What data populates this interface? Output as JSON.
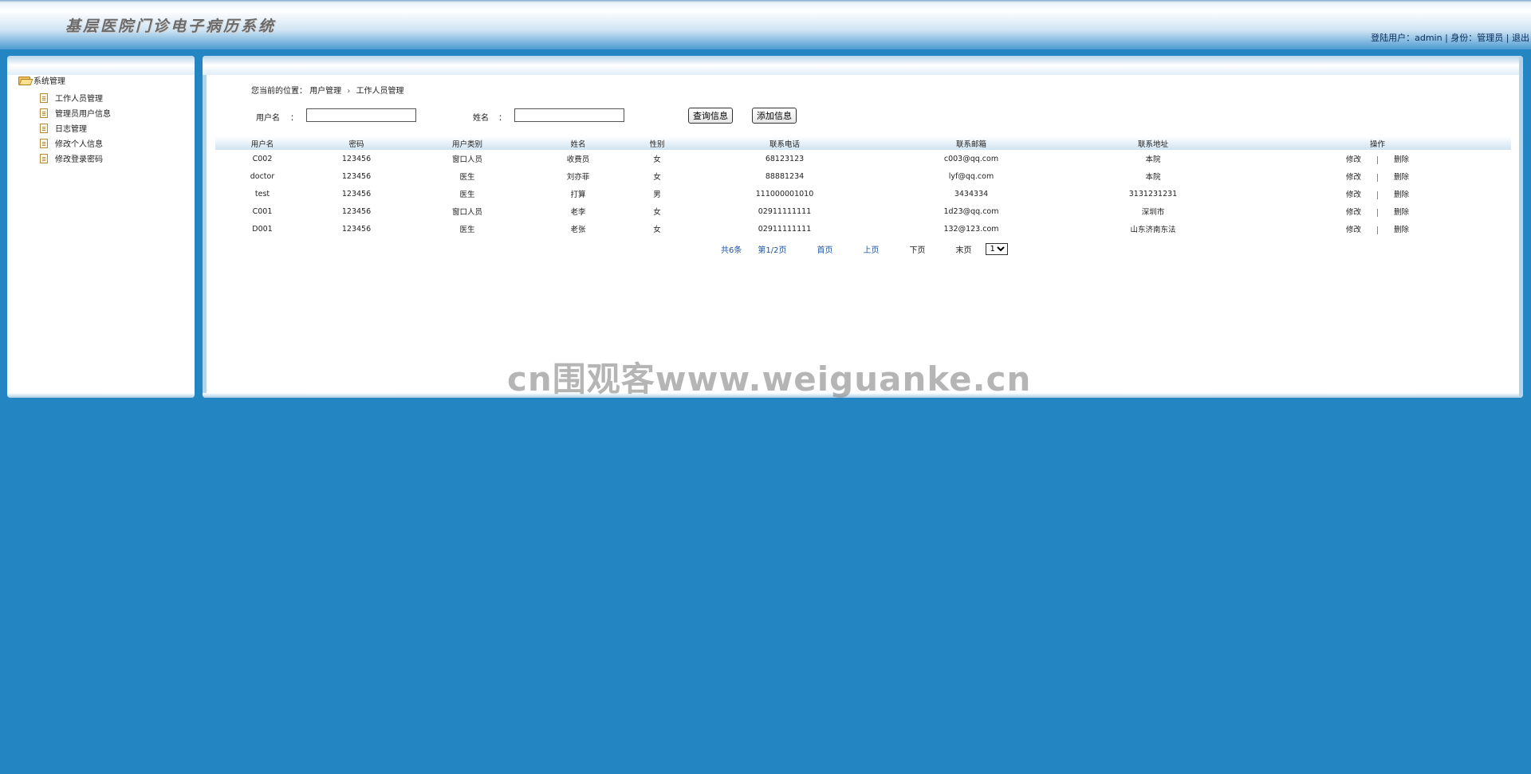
{
  "header": {
    "title": "基层医院门诊电子病历系统",
    "user_label": "登陆用户：",
    "user_name": "admin",
    "separator": "|",
    "role_label": "身份：",
    "role": "管理员",
    "logout": "退出"
  },
  "sidebar": {
    "root": "系统管理",
    "items": [
      {
        "label": "工作人员管理"
      },
      {
        "label": "管理员用户信息"
      },
      {
        "label": "日志管理"
      },
      {
        "label": "修改个人信息"
      },
      {
        "label": "修改登录密码"
      }
    ]
  },
  "breadcrumb": {
    "prefix": "您当前的位置：",
    "level1": "用户管理",
    "sep": "›",
    "level2": "工作人员管理"
  },
  "search": {
    "username_label": "用户名",
    "colon": "：",
    "username_value": "",
    "name_label": "姓名",
    "name_value": "",
    "query_button": "查询信息",
    "add_button": "添加信息"
  },
  "table": {
    "columns": [
      "用户名",
      "密码",
      "用户类别",
      "姓名",
      "性别",
      "联系电话",
      "联系邮箱",
      "联系地址",
      "操作"
    ],
    "rows": [
      [
        "C002",
        "123456",
        "窗口人员",
        "收费员",
        "女",
        "68123123",
        "c003@qq.com",
        "本院"
      ],
      [
        "doctor",
        "123456",
        "医生",
        "刘亦菲",
        "女",
        "88881234",
        "lyf@qq.com",
        "本院"
      ],
      [
        "test",
        "123456",
        "医生",
        "打算",
        "男",
        "111000001010",
        "3434334",
        "3131231231"
      ],
      [
        "C001",
        "123456",
        "窗口人员",
        "老李",
        "女",
        "02911111111",
        "1d23@qq.com",
        "深圳市"
      ],
      [
        "D001",
        "123456",
        "医生",
        "老张",
        "女",
        "02911111111",
        "132@123.com",
        "山东济南东法"
      ]
    ],
    "edit_label": "修改",
    "delete_label": "删除"
  },
  "pager": {
    "total": "共6条",
    "page_info": "第1/2页",
    "first": "首页",
    "prev": "上页",
    "next": "下页",
    "last": "末页",
    "selected_page": "1"
  },
  "watermark": "cn围观客www.weiguanke.cn"
}
